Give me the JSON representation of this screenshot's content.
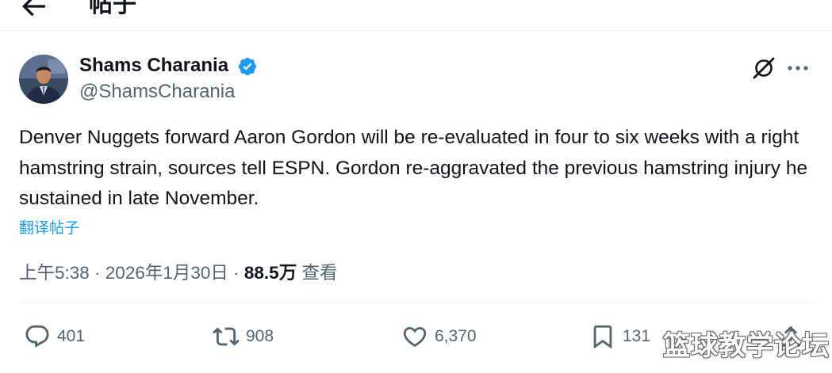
{
  "header": {
    "back_icon": "arrow-left-icon",
    "title": "帖子"
  },
  "author": {
    "display_name": "Shams Charania",
    "handle": "@ShamsCharania",
    "verified": true,
    "verified_color": "#1d9bf0"
  },
  "tweet": {
    "text": "Denver Nuggets forward Aaron Gordon will be re-evaluated in four to six weeks with a right hamstring strain, sources tell ESPN. Gordon re-aggravated the previous hamstring injury he sustained in late November.",
    "translate_label": "翻译帖子"
  },
  "meta": {
    "time": "上午5:38",
    "separator": " · ",
    "date": "2026年1月30日",
    "views_count": "88.5万",
    "views_label": "查看"
  },
  "actions": {
    "replies": "401",
    "reposts": "908",
    "likes": "6,370",
    "bookmarks": "131"
  },
  "icons": {
    "grok": "grok-slash-icon",
    "more": "more-dots-icon",
    "reply": "reply-bubble-icon",
    "repost": "repost-arrows-icon",
    "like": "heart-icon",
    "bookmark": "bookmark-icon",
    "share": "share-icon"
  },
  "watermark": "篮球教学论坛",
  "colors": {
    "text_primary": "#0f1419",
    "text_secondary": "#536471",
    "link": "#1d9bf0",
    "divider": "#eff3f4"
  }
}
